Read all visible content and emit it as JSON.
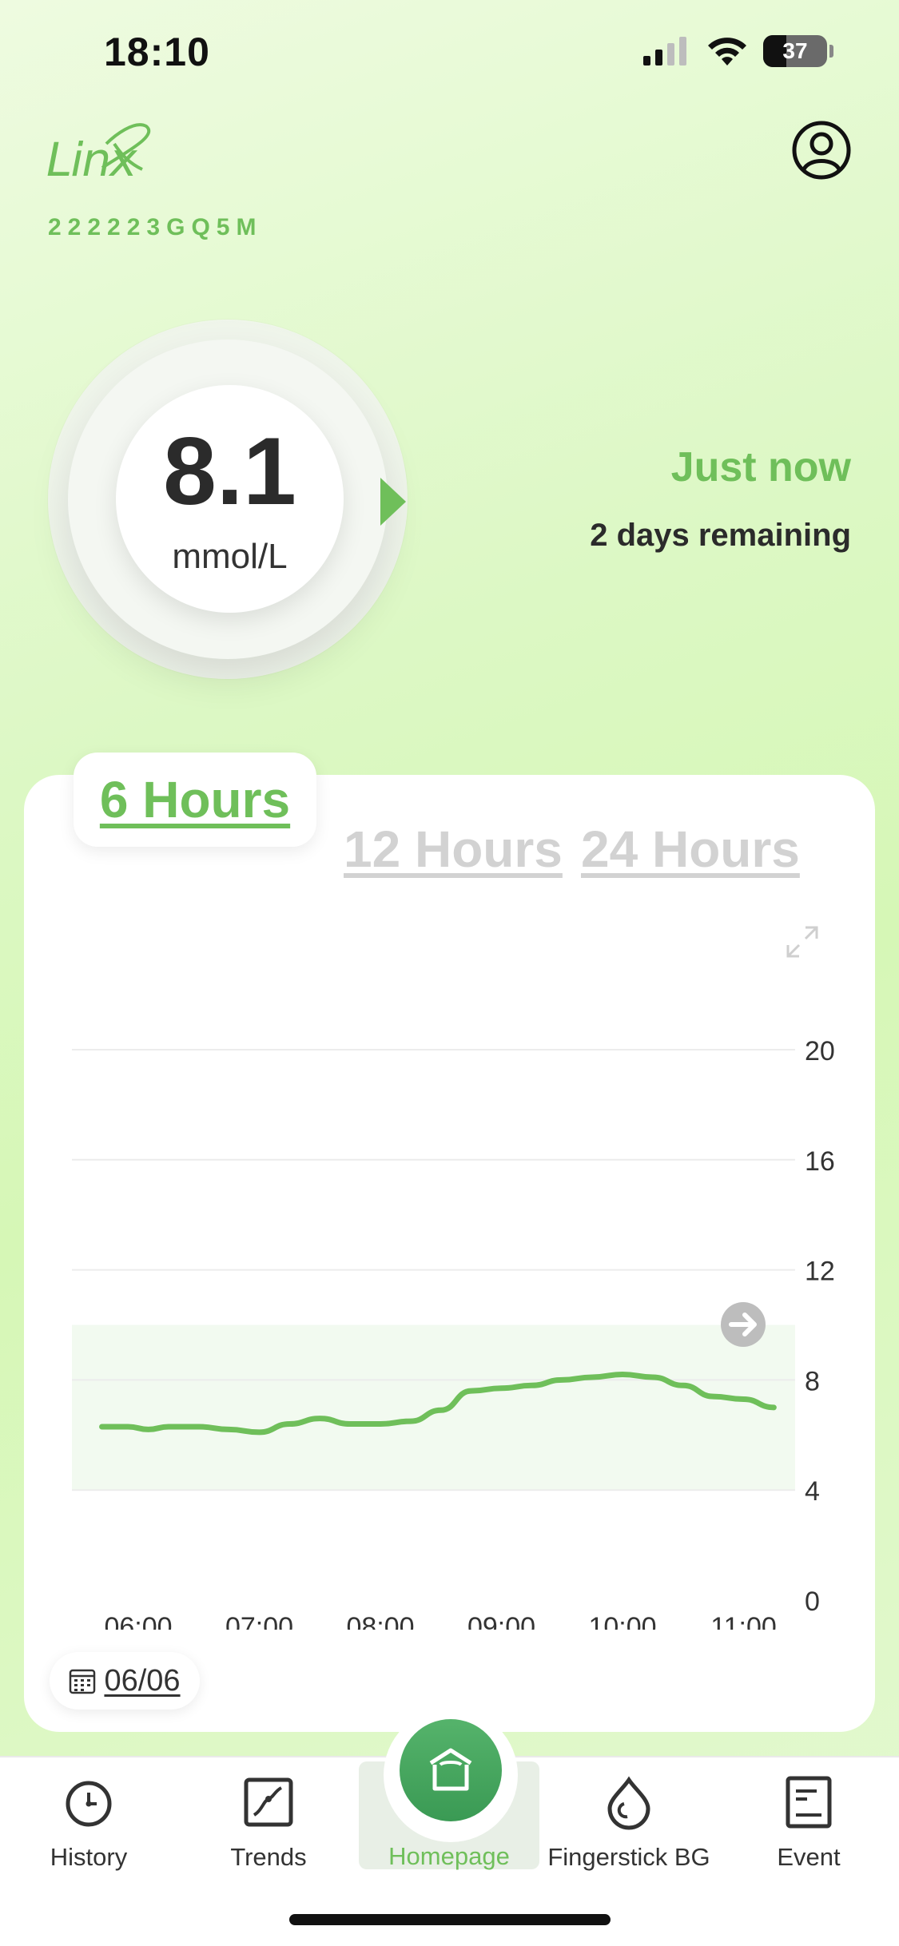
{
  "status_bar": {
    "time": "18:10",
    "battery": "37"
  },
  "header": {
    "logo_text": "Linx",
    "serial": "222223GQ5M"
  },
  "reading": {
    "value": "8.1",
    "unit": "mmol/L",
    "time_label": "Just now",
    "remaining": "2 days remaining"
  },
  "range_tabs": [
    {
      "label": "6 Hours",
      "active": true
    },
    {
      "label": "12 Hours",
      "active": false
    },
    {
      "label": "24 Hours",
      "active": false
    }
  ],
  "date_selector": {
    "date": "06/06"
  },
  "chart_data": {
    "type": "line",
    "x_labels": [
      "06:00",
      "07:00",
      "08:00",
      "09:00",
      "10:00",
      "11:00"
    ],
    "y_ticks": [
      0,
      4,
      8,
      12,
      16,
      20
    ],
    "ylim": [
      0,
      20
    ],
    "target_range": [
      4,
      10
    ],
    "series": [
      {
        "color": "#6fbf5a",
        "points": [
          [
            "05:42",
            6.3
          ],
          [
            "05:55",
            6.3
          ],
          [
            "06:05",
            6.2
          ],
          [
            "06:15",
            6.3
          ],
          [
            "06:30",
            6.3
          ],
          [
            "06:45",
            6.2
          ],
          [
            "07:00",
            6.1
          ],
          [
            "07:15",
            6.4
          ],
          [
            "07:30",
            6.6
          ],
          [
            "07:45",
            6.4
          ],
          [
            "08:00",
            6.4
          ],
          [
            "08:15",
            6.5
          ],
          [
            "08:30",
            6.9
          ],
          [
            "08:45",
            7.6
          ],
          [
            "09:00",
            7.7
          ],
          [
            "09:15",
            7.8
          ],
          [
            "09:30",
            8.0
          ],
          [
            "09:45",
            8.1
          ],
          [
            "10:00",
            8.2
          ],
          [
            "10:15",
            8.1
          ],
          [
            "10:30",
            7.8
          ],
          [
            "10:45",
            7.4
          ],
          [
            "11:00",
            7.3
          ],
          [
            "11:15",
            7.0
          ]
        ]
      }
    ]
  },
  "tab_bar": [
    {
      "label": "History",
      "icon": "clock-icon"
    },
    {
      "label": "Trends",
      "icon": "trends-icon"
    },
    {
      "label": "Homepage",
      "icon": "home-icon"
    },
    {
      "label": "Fingerstick BG",
      "icon": "drop-icon"
    },
    {
      "label": "Event",
      "icon": "note-icon"
    }
  ],
  "colors": {
    "accent": "#6fbf5a",
    "home": "#4caf64"
  }
}
